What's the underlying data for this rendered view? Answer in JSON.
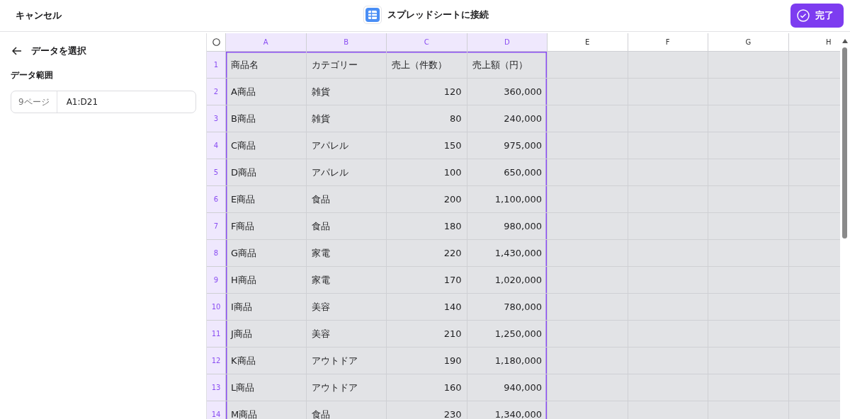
{
  "header": {
    "cancel": "キャンセル",
    "title": "スプレッドシートに接続",
    "done": "完了"
  },
  "sidebar": {
    "back": "データを選択",
    "range_label": "データ範囲",
    "range_field": {
      "prefix": "9ページ",
      "value": "A1:D21"
    }
  },
  "sheet": {
    "columns": [
      {
        "label": "A",
        "selected": true,
        "kind": "text"
      },
      {
        "label": "B",
        "selected": true,
        "kind": "text"
      },
      {
        "label": "C",
        "selected": true,
        "kind": "number"
      },
      {
        "label": "D",
        "selected": true,
        "kind": "number"
      },
      {
        "label": "E",
        "selected": false,
        "kind": "text"
      },
      {
        "label": "F",
        "selected": false,
        "kind": "text"
      },
      {
        "label": "G",
        "selected": false,
        "kind": "text"
      },
      {
        "label": "H",
        "selected": false,
        "kind": "text"
      }
    ],
    "rows": [
      {
        "number": "1",
        "selected": true,
        "kind": "header",
        "cells": [
          "商品名",
          "カテゴリー",
          "売上（件数）",
          "売上額（円）"
        ]
      },
      {
        "number": "2",
        "selected": true,
        "kind": "data",
        "cells": [
          "A商品",
          "雑貨",
          "120",
          "360,000"
        ]
      },
      {
        "number": "3",
        "selected": true,
        "kind": "data",
        "cells": [
          "B商品",
          "雑貨",
          "80",
          "240,000"
        ]
      },
      {
        "number": "4",
        "selected": true,
        "kind": "data",
        "cells": [
          "C商品",
          "アパレル",
          "150",
          "975,000"
        ]
      },
      {
        "number": "5",
        "selected": true,
        "kind": "data",
        "cells": [
          "D商品",
          "アパレル",
          "100",
          "650,000"
        ]
      },
      {
        "number": "6",
        "selected": true,
        "kind": "data",
        "cells": [
          "E商品",
          "食品",
          "200",
          "1,100,000"
        ]
      },
      {
        "number": "7",
        "selected": true,
        "kind": "data",
        "cells": [
          "F商品",
          "食品",
          "180",
          "980,000"
        ]
      },
      {
        "number": "8",
        "selected": true,
        "kind": "data",
        "cells": [
          "G商品",
          "家電",
          "220",
          "1,430,000"
        ]
      },
      {
        "number": "9",
        "selected": true,
        "kind": "data",
        "cells": [
          "H商品",
          "家電",
          "170",
          "1,020,000"
        ]
      },
      {
        "number": "10",
        "selected": true,
        "kind": "data",
        "cells": [
          "I商品",
          "美容",
          "140",
          "780,000"
        ]
      },
      {
        "number": "11",
        "selected": true,
        "kind": "data",
        "cells": [
          "J商品",
          "美容",
          "210",
          "1,250,000"
        ]
      },
      {
        "number": "12",
        "selected": true,
        "kind": "data",
        "cells": [
          "K商品",
          "アウトドア",
          "190",
          "1,180,000"
        ]
      },
      {
        "number": "13",
        "selected": true,
        "kind": "data",
        "cells": [
          "L商品",
          "アウトドア",
          "160",
          "940,000"
        ]
      },
      {
        "number": "14",
        "selected": true,
        "kind": "data",
        "cells": [
          "M商品",
          "食品",
          "230",
          "1,340,000"
        ]
      }
    ]
  }
}
